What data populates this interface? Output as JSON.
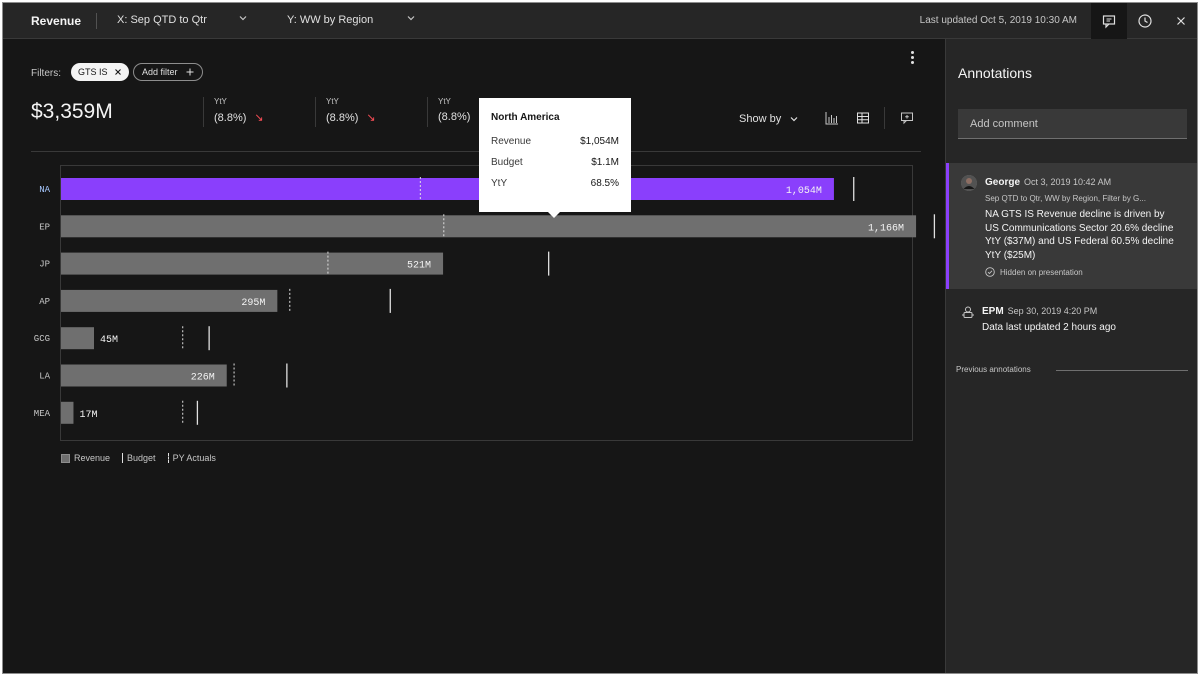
{
  "topbar": {
    "title": "Revenue",
    "x_select": "X: Sep QTD to Qtr",
    "y_select": "Y: WW by Region",
    "last_updated": "Last updated Oct 5, 2019 10:30 AM"
  },
  "filters": {
    "label": "Filters:",
    "chip": "GTS IS",
    "add_filter": "Add filter"
  },
  "summary": {
    "total": "$3,359M",
    "kpis": [
      {
        "label": "YtY",
        "value": "(8.8%)"
      },
      {
        "label": "YtY",
        "value": "(8.8%)"
      },
      {
        "label": "YtY",
        "value": "(8.8%)"
      }
    ],
    "show_by": "Show by"
  },
  "tooltip": {
    "title": "North America",
    "rows": [
      {
        "label": "Revenue",
        "value": "$1,054M"
      },
      {
        "label": "Budget",
        "value": "$1.1M"
      },
      {
        "label": "YtY",
        "value": "68.5%"
      }
    ]
  },
  "chart_data": {
    "type": "bar",
    "orientation": "horizontal",
    "categories": [
      "NA",
      "EP",
      "JP",
      "AP",
      "GCG",
      "LA",
      "MEA"
    ],
    "series": [
      {
        "name": "Revenue",
        "values": [
          1054,
          1166,
          521,
          295,
          45,
          226,
          17
        ]
      },
      {
        "name": "Budget",
        "values": [
          1081,
          1191,
          665,
          449,
          202,
          308,
          186
        ]
      },
      {
        "name": "PY Actuals",
        "values": [
          490,
          522,
          364,
          312,
          166,
          236,
          166
        ]
      }
    ],
    "value_labels": [
      "1,054M",
      "1,166M",
      "521M",
      "295M",
      "45M",
      "226M",
      "17M"
    ],
    "highlighted": "NA",
    "xlim": [
      0,
      1200
    ],
    "colors": {
      "highlight": "#8a3ffc",
      "bar": "#6f6f6f",
      "marker": "#e0e0e0"
    }
  },
  "legend": {
    "revenue": "Revenue",
    "budget": "Budget",
    "py": "PY Actuals"
  },
  "annotations": {
    "title": "Annotations",
    "comment_placeholder": "Add comment",
    "items": [
      {
        "author": "George",
        "date": "Oct 3, 2019 10:42 AM",
        "meta": "Sep QTD to Qtr, WW by Region, Filter by G...",
        "text": "NA GTS IS Revenue decline is driven by US Communications Sector 20.6% decline YtY ($37M) and US Federal 60.5% decline YtY ($25M)",
        "status": "Hidden on presentation"
      },
      {
        "author": "EPM",
        "date": "Sep 30, 2019 4:20 PM",
        "text": "Data last updated 2 hours ago"
      }
    ],
    "previous": "Previous annotations"
  },
  "icons": [
    "chevron-down-icon",
    "comment-icon",
    "history-icon",
    "close-icon",
    "bar-chart-icon",
    "table-icon",
    "annotation-icon",
    "overflow-menu-icon",
    "check-circle-icon",
    "robot-icon"
  ]
}
